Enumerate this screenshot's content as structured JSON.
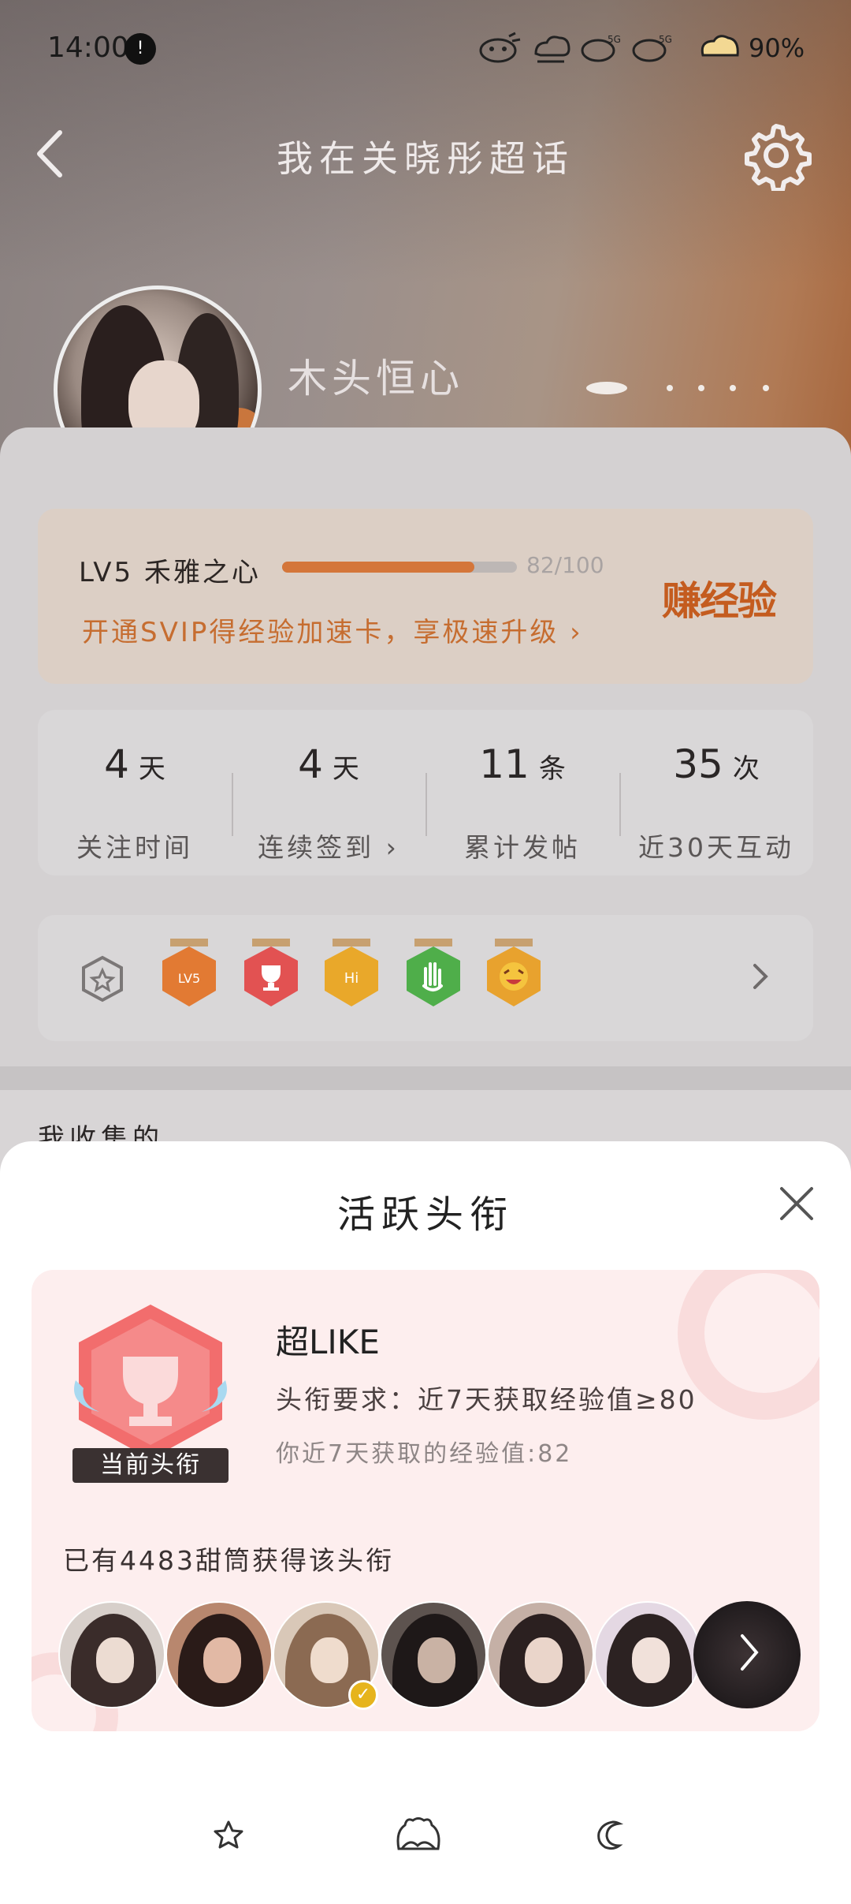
{
  "status_bar": {
    "time": "14:00",
    "notification_badge": "!",
    "battery_percent": "90%",
    "icons": [
      "alarm-icon",
      "cloud-sync-icon",
      "signal-5g-icon",
      "signal-5g-icon",
      "battery-icon"
    ]
  },
  "header": {
    "title": "我在关晓彤超话",
    "back_icon": "chevron-left-icon",
    "settings_icon": "gear-icon"
  },
  "profile": {
    "username": "木头恒心"
  },
  "level": {
    "title": "LV5 禾雅之心",
    "progress_text": "82/100",
    "progress_fraction": 0.82,
    "promo": "开通SVIP得经验加速卡，享极速升级 ›",
    "earn_label": "赚经验"
  },
  "stats": [
    {
      "value": "4",
      "unit": "天",
      "label": "关注时间"
    },
    {
      "value": "4",
      "unit": "天",
      "label": "连续签到 ›"
    },
    {
      "value": "11",
      "unit": "条",
      "label": "累计发帖"
    },
    {
      "value": "35",
      "unit": "次",
      "label": "近30天互动"
    }
  ],
  "badges": {
    "items": [
      "lv5-badge-icon",
      "trophy-badge-icon",
      "hi-badge-icon",
      "hand-badge-icon",
      "laugh-badge-icon"
    ],
    "colors": [
      "#e27a33",
      "#e25252",
      "#e9a82a",
      "#4fae4a",
      "#e8a22e"
    ]
  },
  "section": {
    "collected_label": "我收集的"
  },
  "sheet": {
    "title": "活跃头衔",
    "close_icon": "close-icon",
    "current_label": "当前头衔",
    "title_name": "超LIKE",
    "requirement": "头衔要求：近7天获取经验值≥80",
    "my_value": "你近7天获取的经验值:82",
    "holders_count": "已有4483甜筒获得该头衔",
    "avatars": [
      "fan-avatar-1",
      "fan-avatar-2",
      "fan-avatar-3",
      "fan-avatar-4",
      "fan-avatar-5",
      "fan-avatar-6"
    ],
    "verified_mark": "✓"
  },
  "bottom_nav": [
    "star-icon",
    "cat-face-icon",
    "moon-icon"
  ]
}
